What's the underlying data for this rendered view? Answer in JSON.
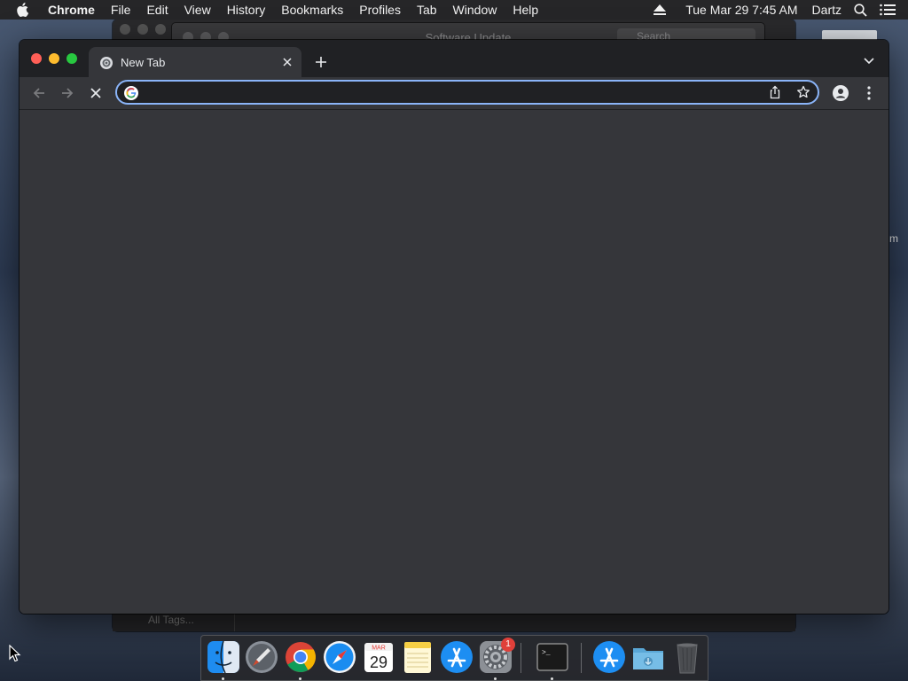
{
  "menubar": {
    "apple_icon": "apple-icon",
    "app_name": "Chrome",
    "menus": [
      "File",
      "Edit",
      "View",
      "History",
      "Bookmarks",
      "Profiles",
      "Tab",
      "Window",
      "Help"
    ],
    "clock": "Tue Mar 29  7:45 AM",
    "user": "Dartz",
    "status_icons": [
      "eject-icon",
      "spotlight-search-icon",
      "control-list-icon"
    ]
  },
  "background_window": {
    "title": "Software Update",
    "search_placeholder": "Search",
    "sidebar_label": "All Tags...",
    "desktop_label": "m"
  },
  "chrome": {
    "tab": {
      "title": "New Tab",
      "favicon": "chrome-newtab-icon"
    },
    "toolbar": {
      "back_icon": "back-arrow-icon",
      "forward_icon": "forward-arrow-icon",
      "stop_icon": "stop-loading-icon",
      "profile_icon": "profile-avatar-icon",
      "menu_icon": "kebab-menu-icon"
    },
    "omnibox": {
      "value": "",
      "placeholder": "",
      "focused": true
    },
    "colors": {
      "frame": "#202124",
      "toolbar": "#35363a",
      "focus_ring": "#8ab4f8"
    }
  },
  "dock": {
    "items": [
      {
        "name": "Finder",
        "icon": "finder-icon",
        "running": true
      },
      {
        "name": "Launchpad",
        "icon": "launchpad-icon",
        "running": false
      },
      {
        "name": "Google Chrome",
        "icon": "chrome-icon",
        "running": true
      },
      {
        "name": "Safari",
        "icon": "safari-icon",
        "running": false
      },
      {
        "name": "Calendar",
        "icon": "calendar-icon",
        "running": false,
        "month": "MAR",
        "day": "29"
      },
      {
        "name": "Notes",
        "icon": "notes-icon",
        "running": false
      },
      {
        "name": "App Store",
        "icon": "app-store-icon",
        "running": false
      },
      {
        "name": "System Preferences",
        "icon": "system-preferences-icon",
        "running": true,
        "badge": "1"
      },
      {
        "name": "Terminal",
        "icon": "terminal-icon",
        "running": true
      },
      {
        "name": "Applications",
        "icon": "app-store-folder-icon",
        "running": false
      },
      {
        "name": "Downloads",
        "icon": "downloads-folder-icon",
        "running": false
      },
      {
        "name": "Trash",
        "icon": "trash-icon",
        "running": false
      }
    ]
  }
}
